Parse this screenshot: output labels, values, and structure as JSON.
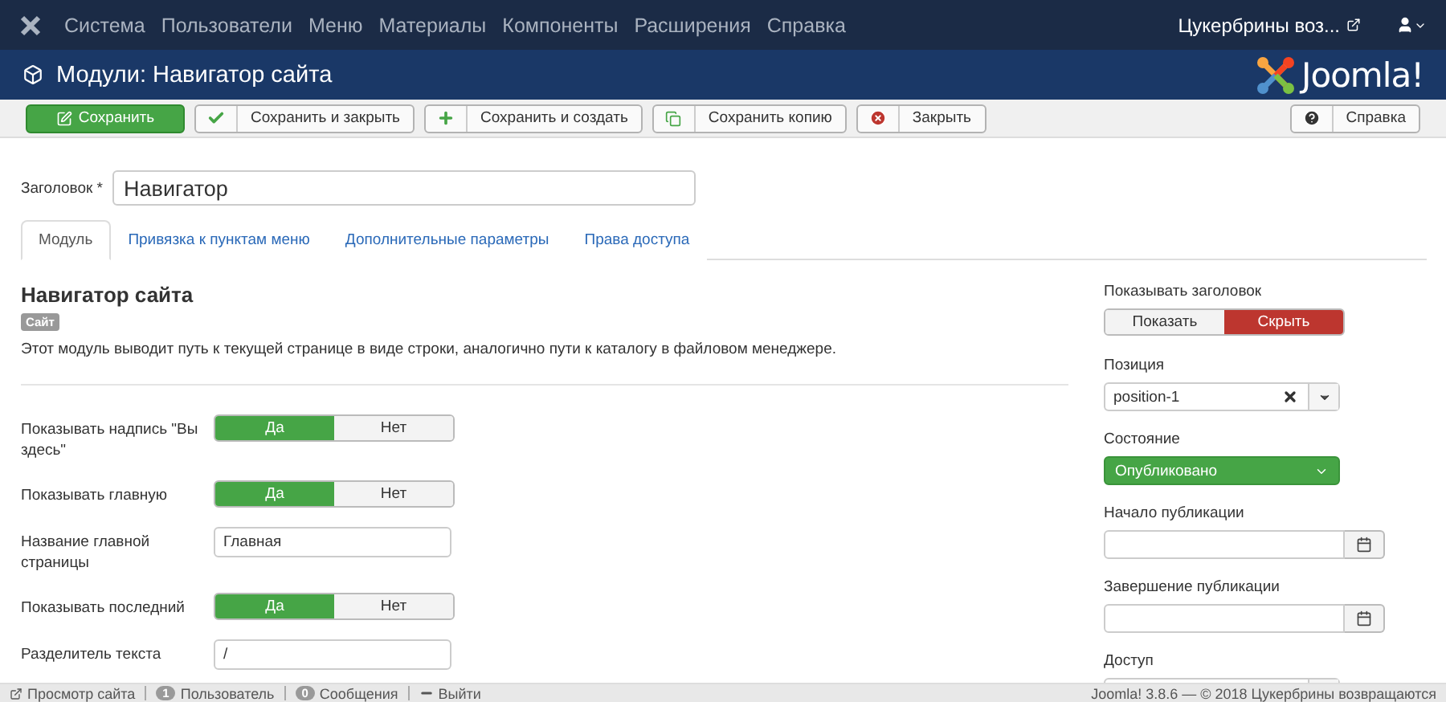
{
  "top_menu": {
    "items": [
      "Система",
      "Пользователи",
      "Меню",
      "Материалы",
      "Компоненты",
      "Расширения",
      "Справка"
    ],
    "site_link": "Цукербрины воз..."
  },
  "header": {
    "title": "Модули: Навигатор сайта",
    "logo_text": "Joomla!"
  },
  "toolbar": {
    "buttons": [
      {
        "label": "Сохранить",
        "kind": "save"
      },
      {
        "label": "Сохранить и закрыть",
        "kind": "save_close"
      },
      {
        "label": "Сохранить и создать",
        "kind": "save_new"
      },
      {
        "label": "Сохранить копию",
        "kind": "save_copy"
      },
      {
        "label": "Закрыть",
        "kind": "close"
      },
      {
        "label": "Справка",
        "kind": "help"
      }
    ]
  },
  "title_field": {
    "label": "Заголовок *",
    "value": "Навигатор"
  },
  "tabs": [
    {
      "label": "Модуль",
      "selected": true
    },
    {
      "label": "Привязка к пунктам меню",
      "selected": false
    },
    {
      "label": "Дополнительные параметры",
      "selected": false
    },
    {
      "label": "Права доступа",
      "selected": false
    }
  ],
  "module": {
    "title": "Навигатор сайта",
    "badge": "Сайт",
    "description": "Этот модуль выводит путь к текущей странице в виде строки, аналогично пути к каталогу в файловом менеджере."
  },
  "params": [
    {
      "kind": "toggle",
      "label": "Показывать надпись \"Вы здесь\"",
      "options": [
        {
          "label": "Да",
          "selected": true
        },
        {
          "label": "Нет",
          "selected": false
        }
      ]
    },
    {
      "kind": "toggle",
      "label": "Показывать главную",
      "options": [
        {
          "label": "Да",
          "selected": true
        },
        {
          "label": "Нет",
          "selected": false
        }
      ]
    },
    {
      "kind": "text",
      "label": "Название главной страницы",
      "value": "Главная"
    },
    {
      "kind": "toggle",
      "label": "Показывать последний",
      "options": [
        {
          "label": "Да",
          "selected": true
        },
        {
          "label": "Нет",
          "selected": false
        }
      ]
    },
    {
      "kind": "text",
      "label": "Разделитель текста",
      "value": "/"
    }
  ],
  "side": [
    {
      "kind": "toggle",
      "label": "Показывать заголовок",
      "options": [
        {
          "label": "Показать",
          "selected": false
        },
        {
          "label": "Скрыть",
          "selected": true
        }
      ]
    },
    {
      "kind": "select",
      "label": "Позиция",
      "value": "position-1"
    },
    {
      "kind": "status",
      "label": "Состояние",
      "value": "Опубликовано"
    },
    {
      "kind": "date",
      "label": "Начало публикации"
    },
    {
      "kind": "date",
      "label": "Завершение публикации"
    },
    {
      "kind": "select",
      "label": "Доступ"
    }
  ],
  "status_bar": {
    "items": [
      {
        "kind": "link",
        "label": "Просмотр сайта"
      },
      {
        "kind": "count",
        "count": "1",
        "label": "Пользователь"
      },
      {
        "kind": "count",
        "count": "0",
        "label": "Сообщения"
      },
      {
        "kind": "logout",
        "label": "Выйти"
      }
    ],
    "footer": "Joomla! 3.8.6 — © 2018 Цукербрины возвращаются"
  }
}
